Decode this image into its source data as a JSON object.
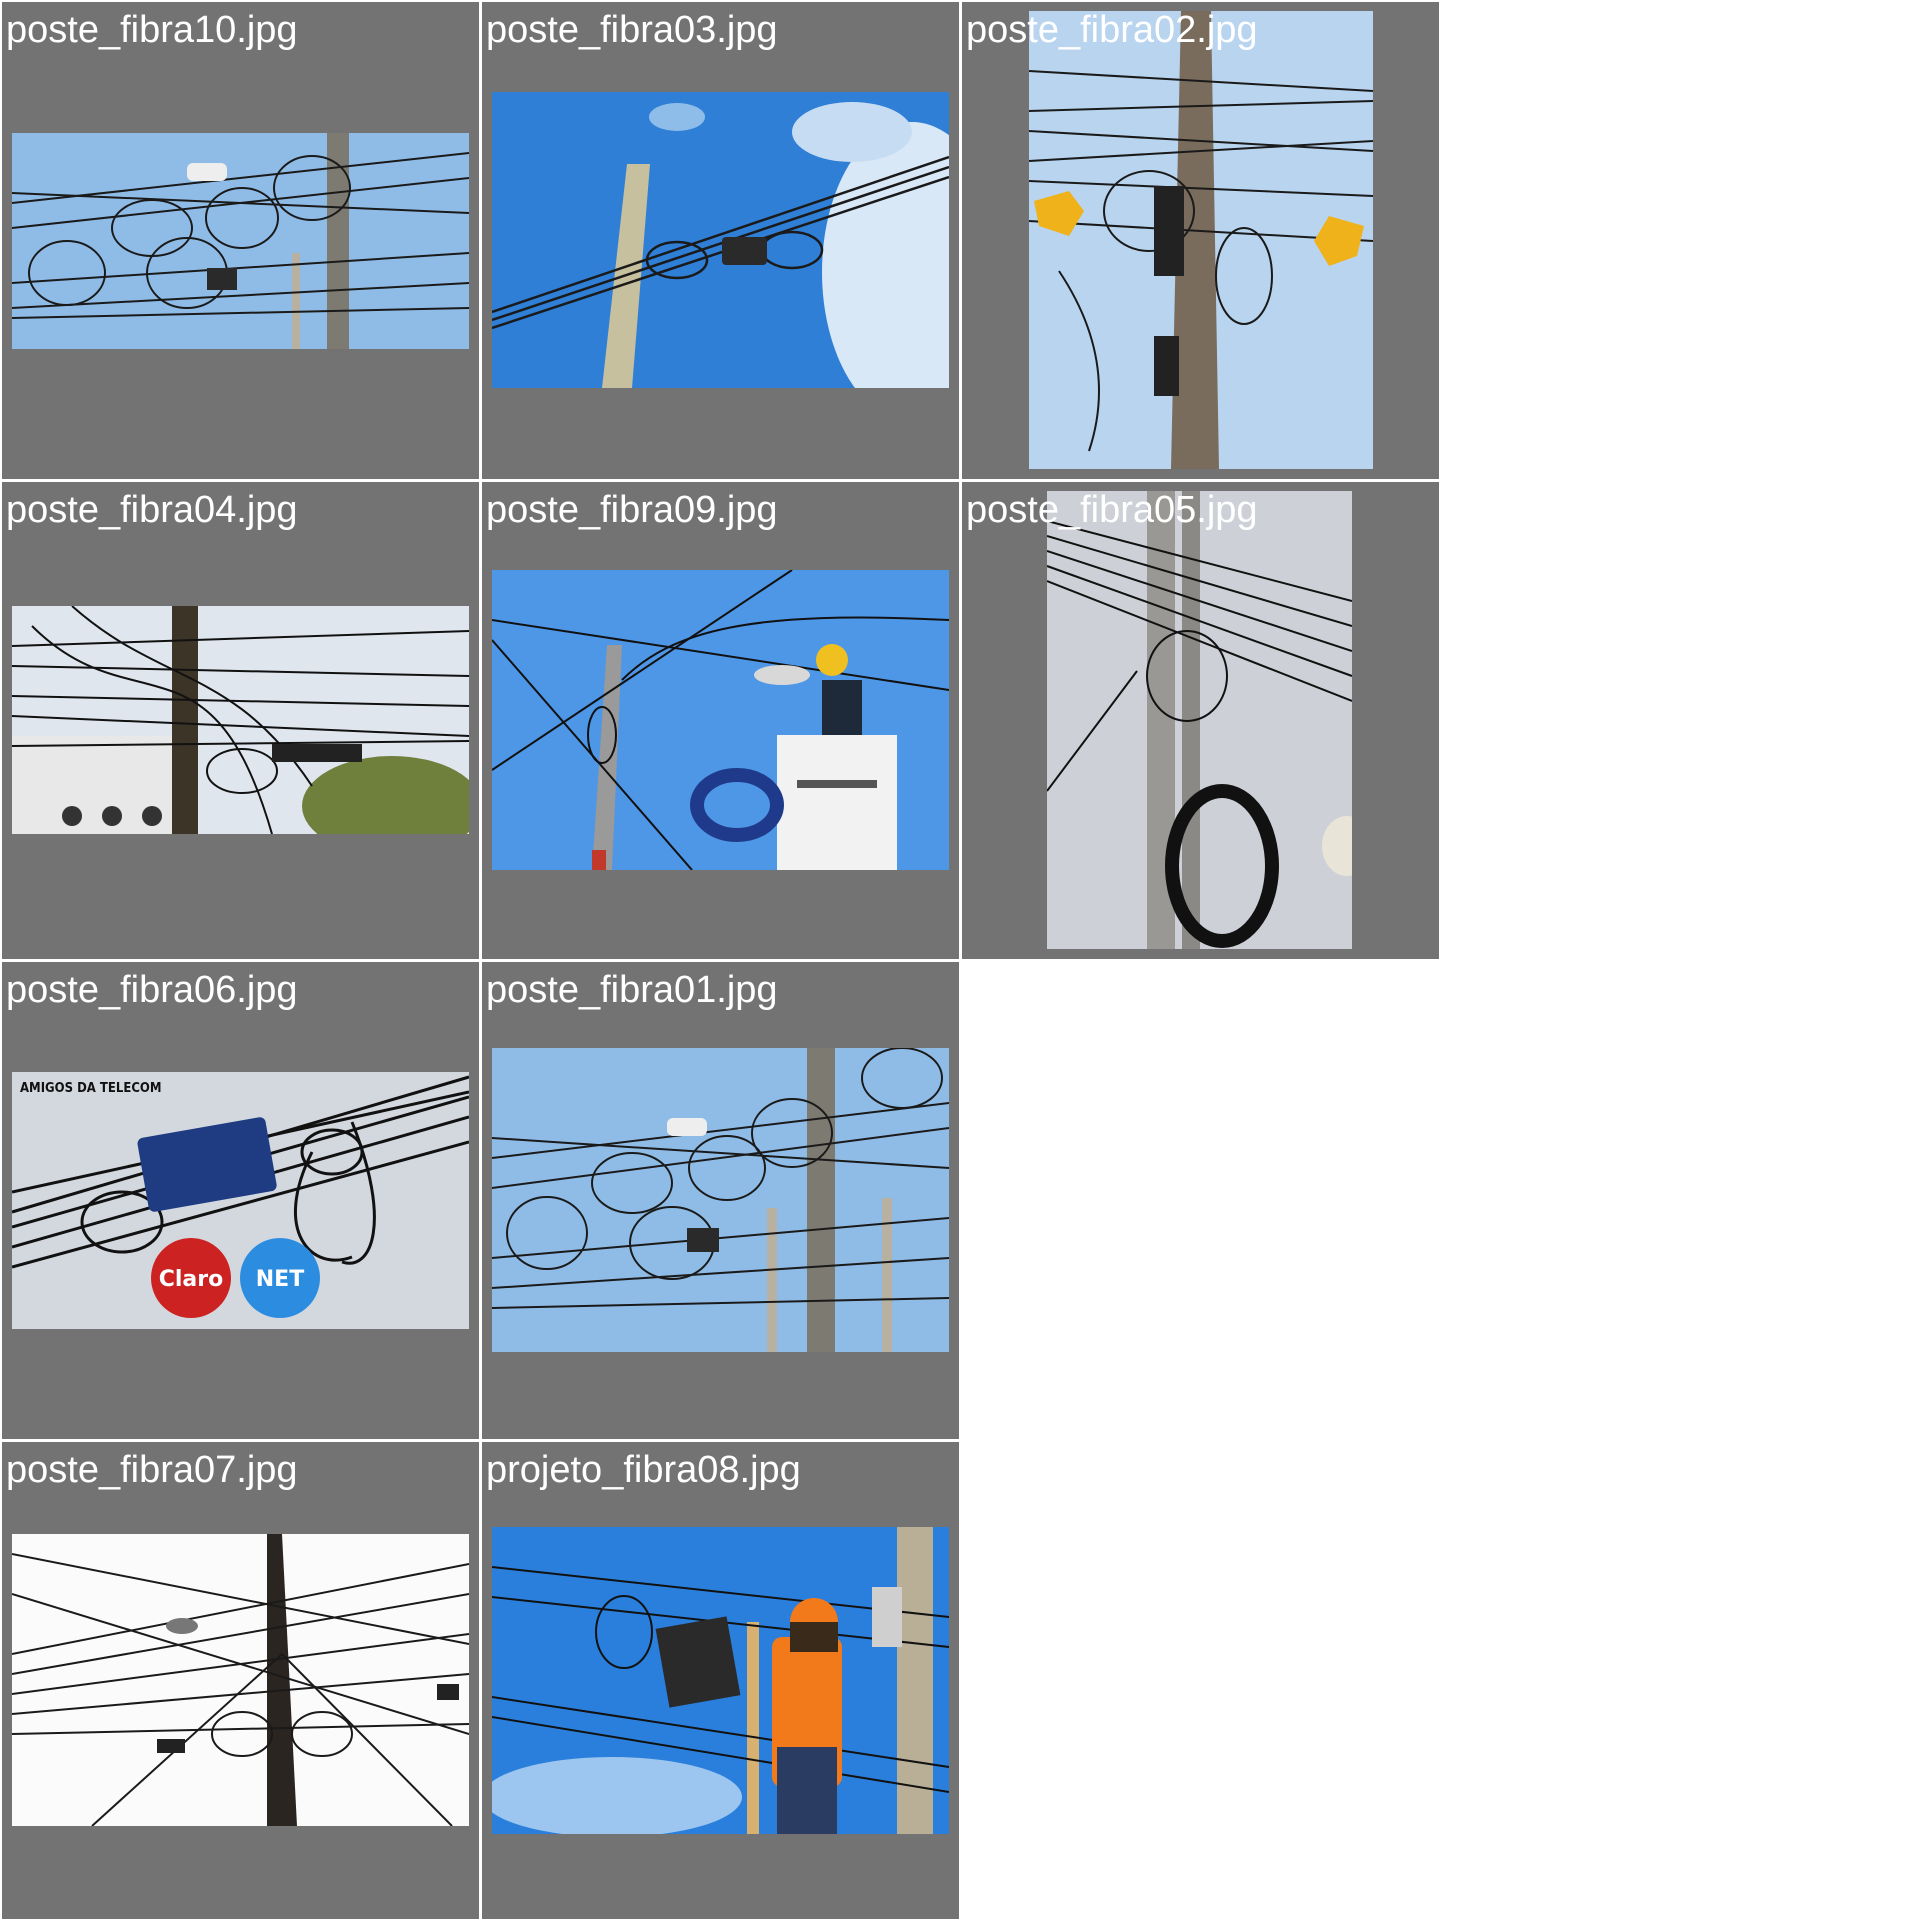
{
  "gallery": {
    "tiles": [
      {
        "filename": "poste_fibra10.jpg",
        "scene": "blue sky, utility pole, many coiled fiber cable loops"
      },
      {
        "filename": "poste_fibra03.jpg",
        "scene": "deep blue sky with clouds, pole, splice box with two loops"
      },
      {
        "filename": "poste_fibra02.jpg",
        "scene": "tall wooden pole, tangled cables, two pointing-hand emojis"
      },
      {
        "filename": "poste_fibra04.jpg",
        "scene": "pale sky, very tangled cables, building and tree"
      },
      {
        "filename": "poste_fibra09.jpg",
        "scene": "worker with yellow helmet in lift bucket near pole and lamp"
      },
      {
        "filename": "poste_fibra05.jpg",
        "scene": "grey sky, pole with large coil of black cable"
      },
      {
        "filename": "poste_fibra06.jpg",
        "scene": "blue splice box on cables with brand logos",
        "badge_text": "AMIGOS DA TELECOM",
        "logo_left": "Claro",
        "logo_right": "NET"
      },
      {
        "filename": "poste_fibra01.jpg",
        "scene": "blue sky, pole with several fiber cable loops"
      },
      {
        "filename": "poste_fibra07.jpg",
        "scene": "white sky, dark silhouette of pole and dense cables"
      },
      {
        "filename": "projeto_fibra08.jpg",
        "scene": "worker with orange helmet and vest working on fiber box at pole"
      }
    ]
  }
}
